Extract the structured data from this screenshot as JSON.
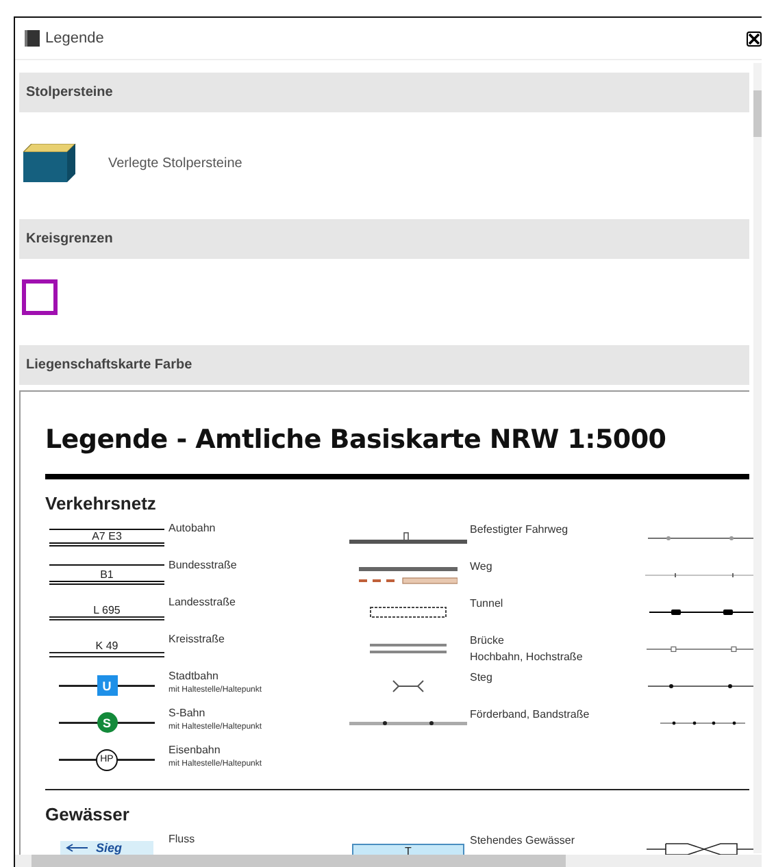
{
  "window": {
    "title": "Legende"
  },
  "sections": [
    {
      "title": "Stolpersteine",
      "kind": "item",
      "label": "Verlegte Stolpersteine"
    },
    {
      "title": "Kreisgrenzen",
      "kind": "boundary",
      "color": "#a010b0"
    },
    {
      "title": "Liegenschaftskarte Farbe",
      "kind": "document"
    }
  ],
  "document": {
    "title": "Legende - Amtliche Basiskarte NRW 1:5000",
    "groups": [
      {
        "heading": "Verkehrsnetz",
        "rows": [
          {
            "left": {
              "kind": "autobahn",
              "sign": "A7  E3",
              "label": "Autobahn"
            },
            "middle": {
              "kind": "fahrweg",
              "label": "Befestigter Fahrweg"
            },
            "right": {
              "kind": "ring-line"
            }
          },
          {
            "left": {
              "kind": "bundesstrasse",
              "sign": "B1",
              "label": "Bundesstraße"
            },
            "middle": {
              "kind": "weg",
              "label": "Weg"
            },
            "right": {
              "kind": "tick-line"
            }
          },
          {
            "left": {
              "kind": "landesstrasse",
              "sign": "L 695",
              "label": "Landesstraße"
            },
            "middle": {
              "kind": "tunnel",
              "label": "Tunnel"
            },
            "right": {
              "kind": "bar-line"
            }
          },
          {
            "left": {
              "kind": "kreisstrasse",
              "sign": "K 49",
              "label": "Kreisstraße"
            },
            "middle": {
              "kind": "bruecke",
              "label": "Brücke",
              "note": "Hochbahn, Hochstraße"
            },
            "right": {
              "kind": "square-line"
            }
          },
          {
            "left": {
              "kind": "stadtbahn",
              "sign": "U",
              "label": "Stadtbahn",
              "note": "mit Haltestelle/Haltepunkt"
            },
            "middle": {
              "kind": "steg",
              "label": "Steg"
            },
            "right": {
              "kind": "dot-line"
            }
          },
          {
            "left": {
              "kind": "sbahn",
              "sign": "S",
              "label": "S-Bahn",
              "note": "mit Haltestelle/Haltepunkt"
            },
            "middle": {
              "kind": "foerderband",
              "label": "Förderband, Bandstraße"
            },
            "right": {
              "kind": "dense-dot-line"
            }
          },
          {
            "left": {
              "kind": "eisenbahn",
              "sign": "HP",
              "label": "Eisenbahn",
              "note": "mit Haltestelle/Haltepunkt"
            }
          }
        ]
      },
      {
        "heading": "Gewässer",
        "rows": [
          {
            "left": {
              "kind": "fluss",
              "sign": "Sieg",
              "label": "Fluss"
            },
            "middle": {
              "kind": "see",
              "sign": "T",
              "label": "Stehendes Gewässer"
            },
            "right": {
              "kind": "culvert"
            }
          }
        ]
      }
    ]
  }
}
